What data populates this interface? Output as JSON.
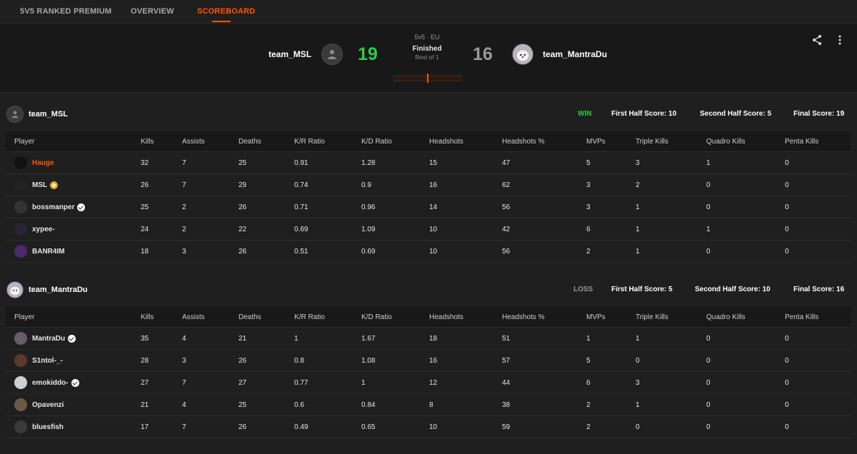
{
  "nav": {
    "tabs": [
      {
        "label": "5V5 RANKED PREMIUM"
      },
      {
        "label": "OVERVIEW"
      },
      {
        "label": "SCOREBOARD"
      }
    ]
  },
  "match": {
    "mode": "5v5 · EU",
    "status": "Finished",
    "best_of": "Best of 1",
    "team1": {
      "name": "team_MSL",
      "score": "19"
    },
    "team2": {
      "name": "team_MantraDu",
      "score": "16"
    }
  },
  "columns": [
    "Player",
    "Kills",
    "Assists",
    "Deaths",
    "K/R Ratio",
    "K/D Ratio",
    "Headshots",
    "Headshots %",
    "MVPs",
    "Triple Kills",
    "Quadro Kills",
    "Penta Kills"
  ],
  "teams": [
    {
      "name": "team_MSL",
      "result": "WIN",
      "first_half": "First Half Score: 10",
      "second_half": "Second Half Score: 5",
      "final": "Final Score: 19",
      "players": [
        {
          "name": "Hauge",
          "badge": "",
          "kills": "32",
          "assists": "7",
          "deaths": "25",
          "kr": "0.91",
          "kd": "1.28",
          "hs": "15",
          "hsp": "47",
          "mvps": "5",
          "triple": "3",
          "quadro": "1",
          "penta": "0"
        },
        {
          "name": "MSL",
          "badge": "gold",
          "kills": "26",
          "assists": "7",
          "deaths": "29",
          "kr": "0.74",
          "kd": "0.9",
          "hs": "16",
          "hsp": "62",
          "mvps": "3",
          "triple": "2",
          "quadro": "0",
          "penta": "0"
        },
        {
          "name": "bossmanper",
          "badge": "verified",
          "kills": "25",
          "assists": "2",
          "deaths": "26",
          "kr": "0.71",
          "kd": "0.96",
          "hs": "14",
          "hsp": "56",
          "mvps": "3",
          "triple": "1",
          "quadro": "0",
          "penta": "0"
        },
        {
          "name": "xypee-",
          "badge": "",
          "kills": "24",
          "assists": "2",
          "deaths": "22",
          "kr": "0.69",
          "kd": "1.09",
          "hs": "10",
          "hsp": "42",
          "mvps": "6",
          "triple": "1",
          "quadro": "1",
          "penta": "0"
        },
        {
          "name": "BANR4IM",
          "badge": "",
          "kills": "18",
          "assists": "3",
          "deaths": "26",
          "kr": "0.51",
          "kd": "0.69",
          "hs": "10",
          "hsp": "56",
          "mvps": "2",
          "triple": "1",
          "quadro": "0",
          "penta": "0"
        }
      ]
    },
    {
      "name": "team_MantraDu",
      "result": "LOSS",
      "first_half": "First Half Score: 5",
      "second_half": "Second Half Score: 10",
      "final": "Final Score: 16",
      "players": [
        {
          "name": "MantraDu",
          "badge": "verified",
          "kills": "35",
          "assists": "4",
          "deaths": "21",
          "kr": "1",
          "kd": "1.67",
          "hs": "18",
          "hsp": "51",
          "mvps": "1",
          "triple": "1",
          "quadro": "0",
          "penta": "0"
        },
        {
          "name": "S1ntol-_-",
          "badge": "",
          "kills": "28",
          "assists": "3",
          "deaths": "26",
          "kr": "0.8",
          "kd": "1.08",
          "hs": "16",
          "hsp": "57",
          "mvps": "5",
          "triple": "0",
          "quadro": "0",
          "penta": "0"
        },
        {
          "name": "emokiddo-",
          "badge": "verified",
          "kills": "27",
          "assists": "7",
          "deaths": "27",
          "kr": "0.77",
          "kd": "1",
          "hs": "12",
          "hsp": "44",
          "mvps": "6",
          "triple": "3",
          "quadro": "0",
          "penta": "0"
        },
        {
          "name": "Opavenzi",
          "badge": "",
          "kills": "21",
          "assists": "4",
          "deaths": "25",
          "kr": "0.6",
          "kd": "0.84",
          "hs": "8",
          "hsp": "38",
          "mvps": "2",
          "triple": "1",
          "quadro": "0",
          "penta": "0"
        },
        {
          "name": "bluesfish",
          "badge": "",
          "kills": "17",
          "assists": "7",
          "deaths": "26",
          "kr": "0.49",
          "kd": "0.65",
          "hs": "10",
          "hsp": "59",
          "mvps": "2",
          "triple": "0",
          "quadro": "0",
          "penta": "0"
        }
      ]
    }
  ],
  "colors": {
    "accent": "#ff5500",
    "win": "#2ecc40",
    "loss": "#9a9a9a"
  },
  "icons": {
    "share": "share-icon",
    "more": "more-vertical-icon",
    "default_avatar": "user-icon"
  }
}
